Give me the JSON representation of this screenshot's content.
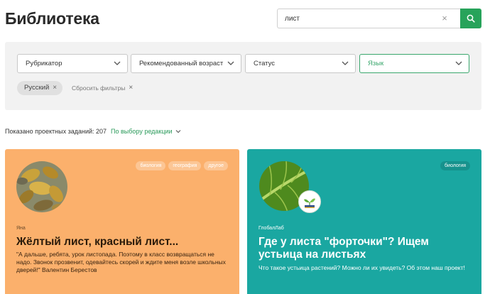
{
  "header": {
    "title": "Библиотека",
    "search": {
      "value": "лист",
      "clear": "×"
    }
  },
  "filters": {
    "dropdowns": [
      {
        "label": "Рубрикатор"
      },
      {
        "label": "Рекомендованный возраст"
      },
      {
        "label": "Статус"
      },
      {
        "label": "Язык"
      }
    ],
    "chip": {
      "label": "Русский",
      "close": "×"
    },
    "reset": {
      "label": "Сбросить фильтры",
      "close": "×"
    }
  },
  "results": {
    "count_text": "Показано проектных заданий: 207",
    "sort_label": "По выбору редакции"
  },
  "cards": [
    {
      "tags": [
        "биология",
        "география",
        "другое"
      ],
      "author": "Яна",
      "title": "Жёлтый лист, красный лист...",
      "description": "\"А дальше, ребята, урок листопада. Поэтому в класс возвращаться не надо. Звонок прозвенит, одевайтесь скорей и ждите меня возле школьных дверей!\" Валентин Берестов",
      "color": "#fbb06c"
    },
    {
      "tags": [
        "биология"
      ],
      "author": "ГлобалЛаб",
      "title": "Где у листа \"форточки\"? Ищем устьица на листьях",
      "description": "Что такое устьица растений? Можно ли их увидеть? Об этом наш проект!",
      "color": "#1aa7a1"
    }
  ],
  "colors": {
    "accent": "#27a35a",
    "panel": "#f2f2f2"
  }
}
